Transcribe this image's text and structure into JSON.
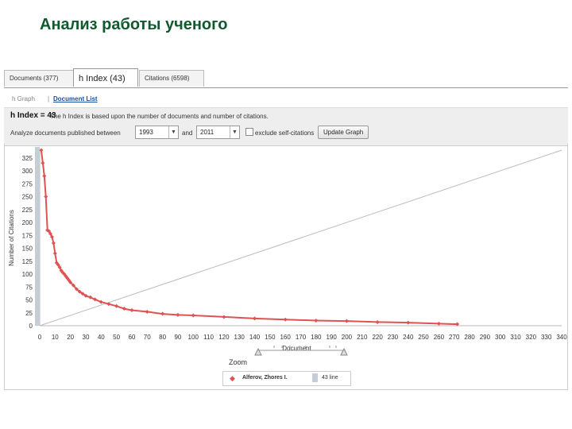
{
  "slide": {
    "title": "Анализ работы ученого"
  },
  "tabs": [
    {
      "label": "Documents (377)"
    },
    {
      "label": "h Index (43)"
    },
    {
      "label": "Citations (6598)"
    }
  ],
  "links": {
    "graph": "h Graph",
    "separator": "|",
    "list": "Document List"
  },
  "hindex": {
    "label": "h Index = 43",
    "desc": "The h Index is based upon the number of documents and number of citations.",
    "analyze_label": "Analyze documents published between",
    "from_year": "1993",
    "and_label": "and",
    "to_year": "2011",
    "exclude_label": "exclude self-citations",
    "update_button": "Update Graph"
  },
  "zoom": {
    "label": "Zoom"
  },
  "legend": {
    "author": "Alferov, Zhores I.",
    "line": "43 line"
  },
  "colors": {
    "series": "#e05252",
    "accent_green": "#0f5a2e",
    "link_blue": "#1a4ea0",
    "bar": "#c5cdd6"
  },
  "chart_data": {
    "type": "scatter",
    "xlabel": "Document",
    "ylabel": "Number of Citations",
    "xlim": [
      0,
      340
    ],
    "ylim": [
      0,
      340
    ],
    "x_ticks": [
      0,
      10,
      20,
      30,
      40,
      50,
      60,
      70,
      80,
      90,
      100,
      110,
      120,
      130,
      140,
      150,
      160,
      170,
      180,
      190,
      200,
      210,
      220,
      230,
      240,
      250,
      260,
      270,
      280,
      290,
      300,
      310,
      320,
      330,
      340
    ],
    "y_ticks": [
      0,
      25,
      50,
      75,
      100,
      125,
      150,
      175,
      200,
      225,
      250,
      275,
      300,
      325
    ],
    "series": [
      {
        "name": "Alferov, Zhores I.",
        "x": [
          1,
          2,
          3,
          4,
          5,
          6,
          7,
          8,
          9,
          10,
          11,
          12,
          13,
          14,
          15,
          16,
          17,
          18,
          19,
          20,
          22,
          24,
          26,
          28,
          30,
          33,
          36,
          40,
          45,
          50,
          55,
          60,
          70,
          80,
          90,
          100,
          120,
          140,
          160,
          180,
          200,
          220,
          240,
          260,
          272
        ],
        "y": [
          340,
          315,
          290,
          250,
          185,
          183,
          178,
          172,
          160,
          140,
          122,
          118,
          113,
          107,
          103,
          100,
          96,
          92,
          88,
          84,
          78,
          71,
          66,
          62,
          58,
          55,
          51,
          46,
          42,
          38,
          33,
          30,
          27,
          23,
          21,
          20,
          17,
          14,
          12,
          10,
          9,
          7,
          6,
          4,
          3
        ]
      },
      {
        "name": "43 line",
        "x": [
          0,
          340
        ],
        "y": [
          0,
          340
        ]
      }
    ]
  }
}
